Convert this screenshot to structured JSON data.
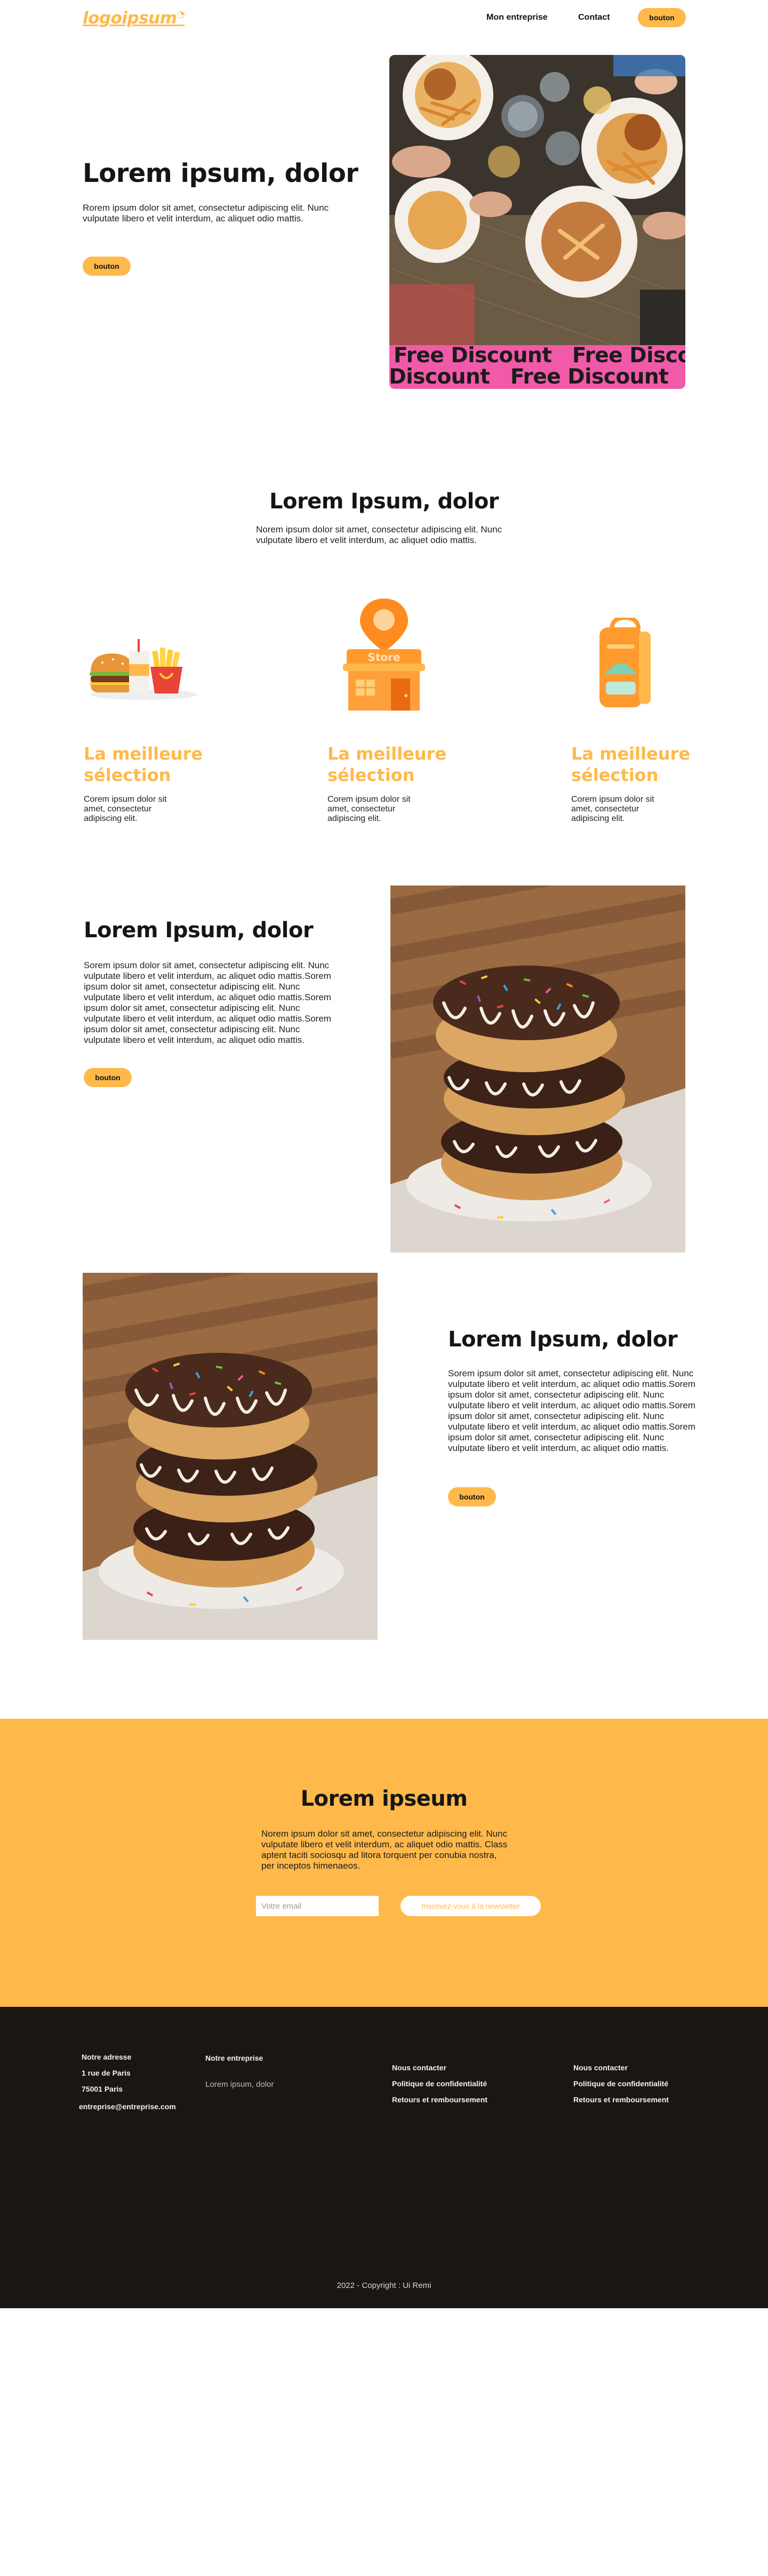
{
  "header": {
    "logo": "logoipsum",
    "nav": [
      "Mon entreprise",
      "Contact"
    ],
    "cta": "bouton"
  },
  "hero": {
    "title": "Lorem ipsum, dolor",
    "text": "Rorem ipsum dolor sit amet, consectetur adipiscing elit. Nunc vulputate libero et velit interdum, ac aliquet odio mattis.",
    "button": "bouton",
    "banner": "Free Discount"
  },
  "intro": {
    "title": "Lorem Ipsum, dolor",
    "text": "Norem ipsum dolor sit amet, consectetur adipiscing elit. Nunc vulputate libero et velit interdum, ac aliquet odio mattis."
  },
  "features": [
    {
      "icon": "burger-combo-icon",
      "title": "La meilleure sélection",
      "text": "Corem ipsum dolor sit amet, consectetur adipiscing elit."
    },
    {
      "icon": "store-icon",
      "store_label": "Store",
      "title": "La meilleure sélection",
      "text": "Corem ipsum dolor sit amet, consectetur adipiscing elit."
    },
    {
      "icon": "delivery-bag-icon",
      "title": "La meilleure sélection",
      "text": "Corem ipsum dolor sit amet, consectetur adipiscing elit."
    }
  ],
  "block1": {
    "title": "Lorem Ipsum, dolor",
    "text": "Sorem ipsum dolor sit amet, consectetur adipiscing elit. Nunc vulputate libero et velit interdum, ac aliquet odio mattis.Sorem ipsum dolor sit amet, consectetur adipiscing elit. Nunc vulputate libero et velit interdum, ac aliquet odio mattis.Sorem ipsum dolor sit amet, consectetur adipiscing elit. Nunc vulputate libero et velit interdum, ac aliquet odio mattis.Sorem ipsum dolor sit amet, consectetur adipiscing elit. Nunc vulputate libero et velit interdum, ac aliquet odio mattis.",
    "button": "bouton"
  },
  "block2": {
    "title": "Lorem Ipsum, dolor",
    "text": "Sorem ipsum dolor sit amet, consectetur adipiscing elit. Nunc vulputate libero et velit interdum, ac aliquet odio mattis.Sorem ipsum dolor sit amet, consectetur adipiscing elit. Nunc vulputate libero et velit interdum, ac aliquet odio mattis.Sorem ipsum dolor sit amet, consectetur adipiscing elit. Nunc vulputate libero et velit interdum, ac aliquet odio mattis.Sorem ipsum dolor sit amet, consectetur adipiscing elit. Nunc vulputate libero et velit interdum, ac aliquet odio mattis.",
    "button": "bouton"
  },
  "newsletter": {
    "title": "Lorem ipseum",
    "text": "Norem ipsum dolor sit amet, consectetur adipiscing elit. Nunc vulputate libero et velit interdum, ac aliquet odio mattis. Class aptent taciti sociosqu ad litora torquent per conubia nostra, per inceptos himenaeos.",
    "placeholder": "Votre email",
    "button": "Inscrivez-vous à la newsletter"
  },
  "footer": {
    "address": [
      "Notre adresse",
      "1 rue de Paris",
      "75001 Paris",
      "entreprise@entreprise.com"
    ],
    "company_title": "Notre entreprise",
    "company_text": "Lorem ipsum, dolor",
    "col3": [
      "Nous contacter",
      "Politique de confidentialité",
      "Retours et remboursement"
    ],
    "col4": [
      "Nous contacter",
      "Politique de confidentialité",
      "Retours et remboursement"
    ],
    "copyright": "2022 - Copyright : Ui Remi"
  },
  "colors": {
    "accent": "#ffb94b",
    "banner": "#f05aa8",
    "footer_bg": "#1a1713"
  }
}
